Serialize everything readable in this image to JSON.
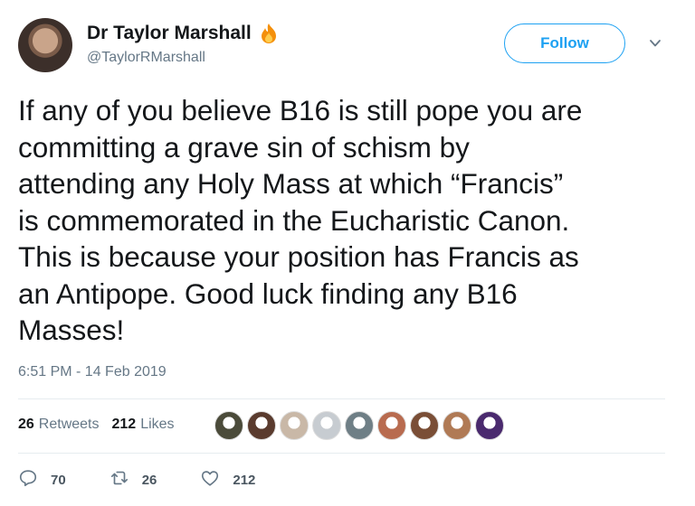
{
  "author": {
    "display_name": "Dr Taylor Marshall",
    "handle": "@TaylorRMarshall",
    "badge_icon": "fire-icon"
  },
  "follow_label": "Follow",
  "tweet": {
    "text": "If any of you believe B16 is still pope you are\ncommitting a grave sin of schism by\nattending any Holy Mass at which “Francis”\nis commemorated in the Eucharistic Canon.\nThis is because your position has Francis as\nan Antipope. Good luck finding any B16\nMasses!",
    "timestamp": "6:51 PM - 14 Feb 2019"
  },
  "stats": {
    "retweets_count": "26",
    "retweets_label": "Retweets",
    "likes_count": "212",
    "likes_label": "Likes"
  },
  "likers": [
    {
      "color": "#4b4b3a"
    },
    {
      "color": "#5a3b2e"
    },
    {
      "color": "#c9b8a7"
    },
    {
      "color": "#c7ccd1"
    },
    {
      "color": "#6f7f86"
    },
    {
      "color": "#b86b4f"
    },
    {
      "color": "#7a4e36"
    },
    {
      "color": "#b07a55"
    },
    {
      "color": "#4a2a6e"
    }
  ],
  "actions": {
    "replies": "70",
    "retweets": "26",
    "likes": "212"
  },
  "colors": {
    "accent": "#1da1f2",
    "secondary_text": "#657786"
  }
}
